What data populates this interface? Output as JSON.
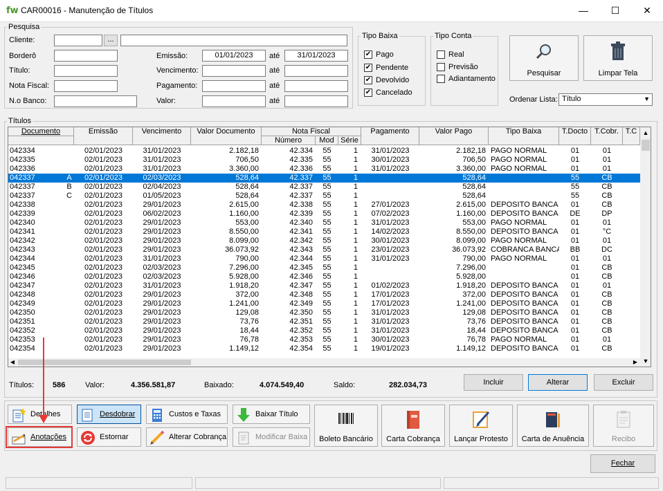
{
  "window": {
    "logo": "fw",
    "title": "CAR00016 - Manutenção de Títulos",
    "min": "—",
    "max": "☐",
    "close": "✕"
  },
  "pesquisa": {
    "caption": "Pesquisa",
    "cliente_label": "Cliente:",
    "cliente_btn": "...",
    "bordero_label": "Borderô",
    "titulo_label": "Título:",
    "nota_label": "Nota Fiscal:",
    "nobanco_label": "N.o Banco:",
    "emissao_label": "Emissão:",
    "emissao_de": "01/01/2023",
    "ate": "até",
    "emissao_ate": "31/01/2023",
    "vencimento_label": "Vencimento:",
    "pagamento_label": "Pagamento:",
    "valor_label": "Valor:"
  },
  "tipo_baixa": {
    "caption": "Tipo Baixa",
    "items": [
      {
        "label": "Pago",
        "checked": "✔"
      },
      {
        "label": "Pendente",
        "checked": "✔"
      },
      {
        "label": "Devolvido",
        "checked": "✔"
      },
      {
        "label": "Cancelado",
        "checked": "✔"
      }
    ]
  },
  "tipo_conta": {
    "caption": "Tipo Conta",
    "items": [
      {
        "label": "Real"
      },
      {
        "label": "Previsão"
      },
      {
        "label": "Adiantamento"
      }
    ]
  },
  "actions": {
    "pesquisar": "Pesquisar",
    "limpar": "Limpar Tela",
    "ordenar_label": "Ordenar Lista:",
    "ordenar_value": "Título"
  },
  "titulos": {
    "caption": "Títulos",
    "headers": {
      "documento": "Documento",
      "emissao": "Emissão",
      "vencimento": "Vencimento",
      "valor_doc": "Valor Documento",
      "nota_fiscal": "Nota Fiscal",
      "numero": "Número",
      "mod": "Mod",
      "serie": "Série",
      "pagamento": "Pagamento",
      "valor_pago": "Valor Pago",
      "tipo_baixa": "Tipo Baixa",
      "tdocto": "T.Docto",
      "tcobr": "T.Cobr.",
      "tc": "T.C"
    },
    "rows": [
      [
        "042334",
        "",
        "02/01/2023",
        "31/01/2023",
        "2.182,18",
        "42.334",
        "55",
        "1",
        "31/01/2023",
        "2.182,18",
        "PAGO NORMAL",
        "01",
        "01"
      ],
      [
        "042335",
        "",
        "02/01/2023",
        "31/01/2023",
        "706,50",
        "42.335",
        "55",
        "1",
        "30/01/2023",
        "706,50",
        "PAGO NORMAL",
        "01",
        "01"
      ],
      [
        "042336",
        "",
        "02/01/2023",
        "31/01/2023",
        "3.360,00",
        "42.336",
        "55",
        "1",
        "31/01/2023",
        "3.360,00",
        "PAGO NORMAL",
        "01",
        "01"
      ],
      [
        "042337",
        "A",
        "02/01/2023",
        "02/03/2023",
        "528,64",
        "42.337",
        "55",
        "1",
        "",
        "528,64",
        "",
        "55",
        "CB"
      ],
      [
        "042337",
        "B",
        "02/01/2023",
        "02/04/2023",
        "528,64",
        "42.337",
        "55",
        "1",
        "",
        "528,64",
        "",
        "55",
        "CB"
      ],
      [
        "042337",
        "C",
        "02/01/2023",
        "01/05/2023",
        "528,64",
        "42.337",
        "55",
        "1",
        "",
        "528,64",
        "",
        "55",
        "CB"
      ],
      [
        "042338",
        "",
        "02/01/2023",
        "29/01/2023",
        "2.615,00",
        "42.338",
        "55",
        "1",
        "27/01/2023",
        "2.615,00",
        "DEPOSITO BANCA",
        "01",
        "CB"
      ],
      [
        "042339",
        "",
        "02/01/2023",
        "06/02/2023",
        "1.160,00",
        "42.339",
        "55",
        "1",
        "07/02/2023",
        "1.160,00",
        "DEPOSITO BANCA",
        "DE",
        "DP"
      ],
      [
        "042340",
        "",
        "02/01/2023",
        "29/01/2023",
        "553,00",
        "42.340",
        "55",
        "1",
        "31/01/2023",
        "553,00",
        "PAGO NORMAL",
        "01",
        "01"
      ],
      [
        "042341",
        "",
        "02/01/2023",
        "29/01/2023",
        "8.550,00",
        "42.341",
        "55",
        "1",
        "14/02/2023",
        "8.550,00",
        "DEPOSITO BANCA",
        "01",
        "°C"
      ],
      [
        "042342",
        "",
        "02/01/2023",
        "29/01/2023",
        "8.099,00",
        "42.342",
        "55",
        "1",
        "30/01/2023",
        "8.099,00",
        "PAGO NORMAL",
        "01",
        "01"
      ],
      [
        "042343",
        "",
        "02/01/2023",
        "29/01/2023",
        "36.073,92",
        "42.343",
        "55",
        "1",
        "23/01/2023",
        "36.073,92",
        "COBRANCA BANCA",
        "BB",
        "DC"
      ],
      [
        "042344",
        "",
        "02/01/2023",
        "31/01/2023",
        "790,00",
        "42.344",
        "55",
        "1",
        "31/01/2023",
        "790,00",
        "PAGO NORMAL",
        "01",
        "01"
      ],
      [
        "042345",
        "",
        "02/01/2023",
        "02/03/2023",
        "7.296,00",
        "42.345",
        "55",
        "1",
        "",
        "7.296,00",
        "",
        "01",
        "CB"
      ],
      [
        "042346",
        "",
        "02/01/2023",
        "02/03/2023",
        "5.928,00",
        "42.346",
        "55",
        "1",
        "",
        "5.928,00",
        "",
        "01",
        "CB"
      ],
      [
        "042347",
        "",
        "02/01/2023",
        "31/01/2023",
        "1.918,20",
        "42.347",
        "55",
        "1",
        "01/02/2023",
        "1.918,20",
        "DEPOSITO BANCA",
        "01",
        "01"
      ],
      [
        "042348",
        "",
        "02/01/2023",
        "29/01/2023",
        "372,00",
        "42.348",
        "55",
        "1",
        "17/01/2023",
        "372,00",
        "DEPOSITO BANCA",
        "01",
        "CB"
      ],
      [
        "042349",
        "",
        "02/01/2023",
        "29/01/2023",
        "1.241,00",
        "42.349",
        "55",
        "1",
        "17/01/2023",
        "1.241,00",
        "DEPOSITO BANCA",
        "01",
        "CB"
      ],
      [
        "042350",
        "",
        "02/01/2023",
        "29/01/2023",
        "129,08",
        "42.350",
        "55",
        "1",
        "31/01/2023",
        "129,08",
        "DEPOSITO BANCA",
        "01",
        "CB"
      ],
      [
        "042351",
        "",
        "02/01/2023",
        "29/01/2023",
        "73,76",
        "42.351",
        "55",
        "1",
        "31/01/2023",
        "73,76",
        "DEPOSITO BANCA",
        "01",
        "CB"
      ],
      [
        "042352",
        "",
        "02/01/2023",
        "29/01/2023",
        "18,44",
        "42.352",
        "55",
        "1",
        "31/01/2023",
        "18,44",
        "DEPOSITO BANCA",
        "01",
        "CB"
      ],
      [
        "042353",
        "",
        "02/01/2023",
        "29/01/2023",
        "76,78",
        "42.353",
        "55",
        "1",
        "30/01/2023",
        "76,78",
        "PAGO NORMAL",
        "01",
        "01"
      ],
      [
        "042354",
        "",
        "02/01/2023",
        "29/01/2023",
        "1.149,12",
        "42.354",
        "55",
        "1",
        "19/01/2023",
        "1.149,12",
        "DEPOSITO BANCA",
        "01",
        "CB"
      ]
    ],
    "selected_row": 3
  },
  "totals": {
    "titulos_label": "Títulos:",
    "titulos": "586",
    "valor_label": "Valor:",
    "valor": "4.356.581,87",
    "baixado_label": "Baixado:",
    "baixado": "4.074.549,40",
    "saldo_label": "Saldo:",
    "saldo": "282.034,73"
  },
  "crud": {
    "incluir": "Incluir",
    "alterar": "Alterar",
    "excluir": "Excluir"
  },
  "toolbar": {
    "detalhes": "Detalhes",
    "desdobrar": "Desdobrar",
    "custos": "Custos e Taxas",
    "baixar": "Baixar Título",
    "anotacoes": "Anotações",
    "estornar": "Estornar",
    "alterar_cobranca": "Alterar Cobrança",
    "modificar_baixa": "Modificar Baixa",
    "boleto": "Boleto Bancário",
    "carta_cobranca": "Carta Cobrança",
    "lancar_protesto": "Lançar Protesto",
    "carta_anuencia": "Carta de Anuência",
    "recibo": "Recibo",
    "fechar": "Fechar"
  }
}
